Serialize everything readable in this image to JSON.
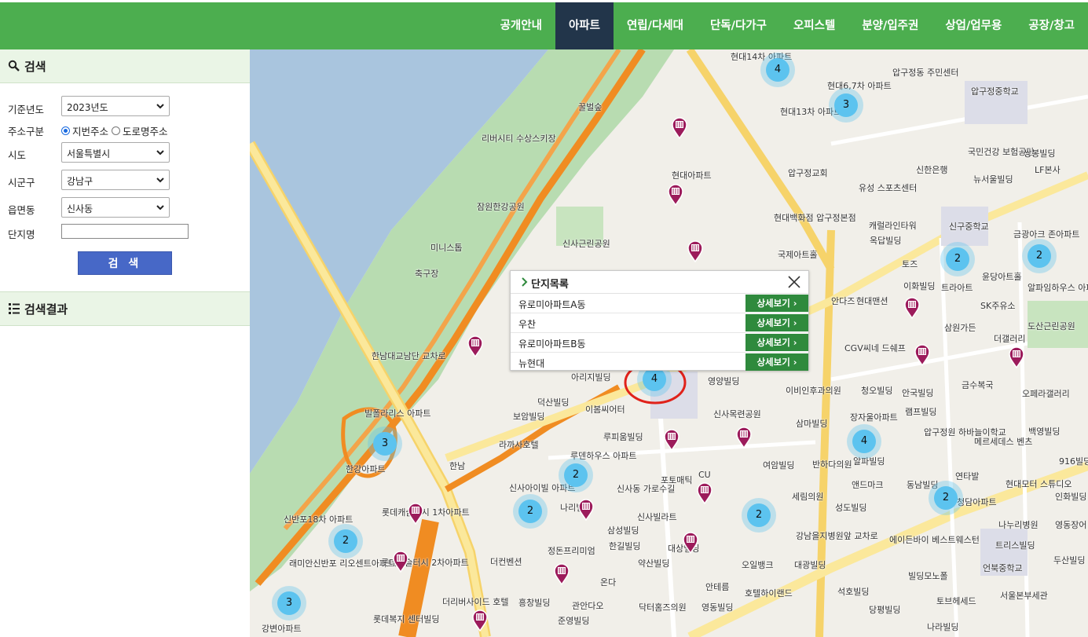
{
  "nav": {
    "items": [
      "공개안내",
      "아파트",
      "연립/다세대",
      "단독/다가구",
      "오피스텔",
      "분양/입주권",
      "상업/업무용",
      "공장/창고"
    ],
    "active_index": 1
  },
  "sidebar": {
    "search_title": "검색",
    "year_label": "기준년도",
    "year_value": "2023년도",
    "address_type_label": "주소구분",
    "address_options": [
      "지번주소",
      "도로명주소"
    ],
    "address_selected": "지번주소",
    "sido_label": "시도",
    "sido_value": "서울특별시",
    "sigungu_label": "시군구",
    "sigungu_value": "강남구",
    "eupmyeondong_label": "읍면동",
    "eupmyeondong_value": "신사동",
    "complex_label": "단지명",
    "complex_value": "",
    "search_button": "검 색",
    "results_title": "검색결과"
  },
  "popup": {
    "title": "단지목록",
    "detail_label": "상세보기",
    "rows": [
      "유로미아파트A동",
      "우찬",
      "유로미아파트B동",
      "뉴현대"
    ]
  },
  "map": {
    "clusters": [
      "4",
      "3",
      "3",
      "2",
      "2",
      "2",
      "2",
      "2",
      "2",
      "4",
      "3",
      "2",
      "4"
    ],
    "labels": [
      "현대14차 아파트",
      "압구정동 주민센터",
      "현대6,7차 아파트",
      "현대13차 아파트",
      "꿀벌숲",
      "리버시티 수상스키장",
      "현대아파트",
      "압구정교회",
      "신한은행",
      "뉴서울빌딩",
      "국민건강 보험공단",
      "쌍봉빌딩",
      "LF본사",
      "압구정중학교",
      "잠원한강공원",
      "신사근린공원",
      "미니스톱",
      "축구장",
      "유성 스포츠센터",
      "캐럴라인타워",
      "옥답빌딩",
      "현대백화점 압구정본점",
      "국제아트홀",
      "토즈",
      "신구중학교",
      "금광아크 존아파트",
      "이화빌딩",
      "트라아트",
      "윤당아트홀",
      "SK주유소",
      "알파임하우스 아파트",
      "도산근린공원",
      "한남대교남단 교차로",
      "빌폴라리스 아파트",
      "한강아파트",
      "안다즈",
      "현대맨션",
      "삼원가든",
      "CGV씨네 드쉐프",
      "더갤러리",
      "아리지빌딩",
      "영양빌딩",
      "이비인후과의원",
      "청오빌딩",
      "안국빌딩",
      "금수복국",
      "오페라갤러리",
      "덕산빌딩",
      "이봄씨어터",
      "보암빌딩",
      "라까사호텔",
      "신사목련공원",
      "삼마빌딩",
      "장자울아파트",
      "램프빌딩",
      "루피움빌딩",
      "압구정원 하바늘이학교",
      "메르세데스 벤츠",
      "백영빌딩",
      "루덴하우스 아파트",
      "신사동 가로수길",
      "포토매틱",
      "CU",
      "여암빌딩",
      "반하다의원",
      "알파빌딩",
      "앤드마크",
      "동남빌딩",
      "연타발",
      "현대모터 스튜디오",
      "916빌딩",
      "한남",
      "신사아이빌 아파트",
      "세림의원",
      "청담아파트",
      "인화빌딩",
      "신반포18차 아파트",
      "롯데캐슬터시 1차아파트",
      "나리빌딩",
      "삼성빌딩",
      "신사빌라트",
      "성도빌딩",
      "나누리병원",
      "영동장어",
      "래미안신반포 리오센트아파트",
      "정돈프리미엄",
      "한길빌딩",
      "에이든바이 베스트웨스턴",
      "트리스빌딩",
      "롯데캐슬터시 2차아파트",
      "더컨벤션",
      "약산빌딩",
      "대상빌딩",
      "오일뱅크",
      "대광빌딩",
      "빌딩모노폴",
      "언북중학교",
      "두산빌딩",
      "온다",
      "안테름",
      "호텔하이랜드",
      "석호빌딩",
      "당평빌딩",
      "토브헤세드",
      "서울본부세관",
      "더리버사이드 호텔",
      "흥창빌딩",
      "관안다오",
      "닥터홈즈의원",
      "영동빌딩",
      "준영빌딩",
      "롯데복지 센터빌딩",
      "강변아파트",
      "나라빌딩",
      "강남을지병원앞 교차로"
    ]
  }
}
